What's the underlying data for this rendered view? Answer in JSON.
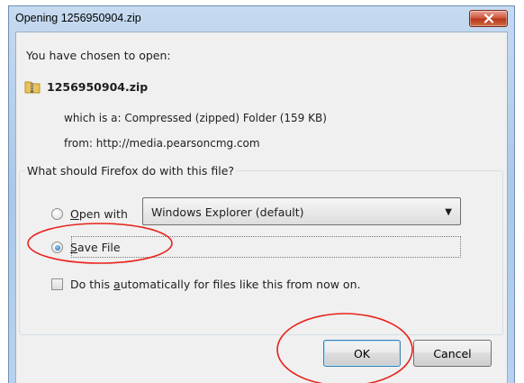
{
  "window": {
    "title": "Opening 1256950904.zip",
    "close_icon": "close-icon"
  },
  "content": {
    "chosen_label": "You have chosen to open:",
    "file_icon": "zip-folder-icon",
    "file_name": "1256950904.zip",
    "which_is_a": "which is a:  Compressed (zipped) Folder (159 KB)",
    "from": "from:  http://media.pearsoncmg.com"
  },
  "group": {
    "legend": "What should Firefox do with this file?",
    "open_with": {
      "mnemonic": "O",
      "rest": "pen with",
      "selected": false,
      "app_options": [
        "Windows Explorer (default)"
      ],
      "app_selected": "Windows Explorer (default)"
    },
    "save_file": {
      "mnemonic": "S",
      "rest": "ave File",
      "selected": true
    },
    "auto_checkbox": {
      "before": "Do this ",
      "mnemonic": "a",
      "after": "utomatically for files like this from now on.",
      "checked": false
    }
  },
  "buttons": {
    "ok": "OK",
    "cancel": "Cancel"
  },
  "annotation_color": "#e8231b"
}
